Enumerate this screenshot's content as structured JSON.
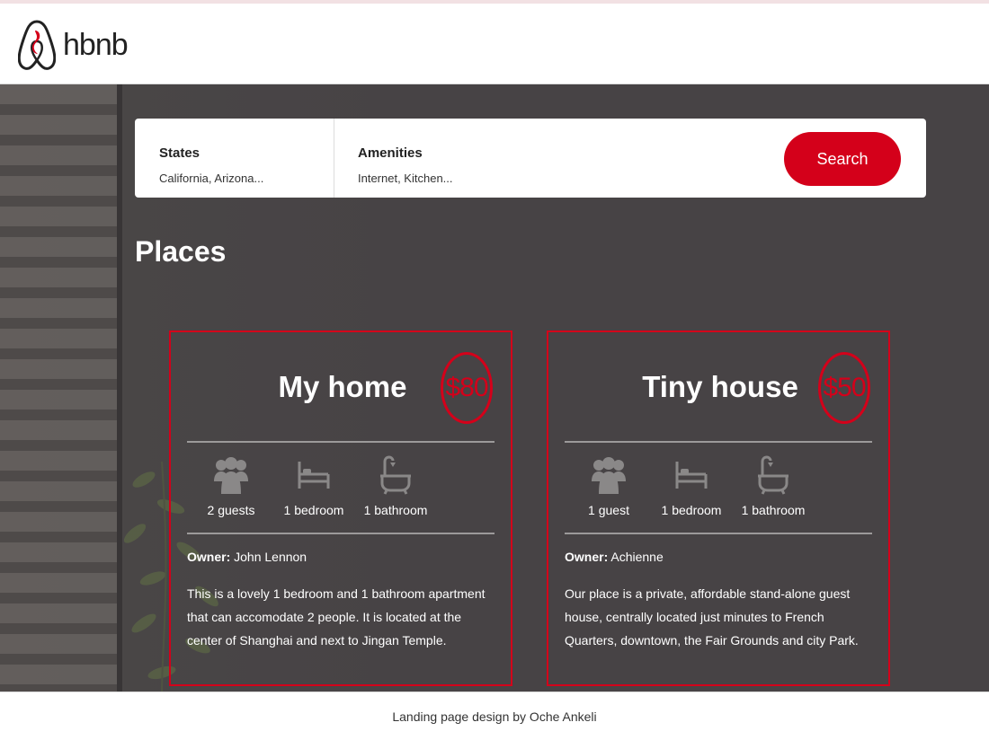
{
  "header": {
    "logo_text": "hbnb",
    "logo_icon": "hbnb-logo-icon"
  },
  "filters": {
    "states": {
      "title": "States",
      "value": "California, Arizona..."
    },
    "amenities": {
      "title": "Amenities",
      "value": "Internet, Kitchen..."
    },
    "search_label": "Search"
  },
  "places": {
    "title": "Places",
    "items": [
      {
        "name": "My home",
        "price": "$80",
        "guests": "2 guests",
        "bedrooms": "1 bedroom",
        "bathrooms": "1 bathroom",
        "owner_label": "Owner:",
        "owner": "John Lennon",
        "description": "This is a lovely 1 bedroom and 1 bathroom apartment that can accomodate 2 people. It is located at the center of Shanghai and next to Jingan Temple."
      },
      {
        "name": "Tiny house",
        "price": "$50",
        "guests": "1 guest",
        "bedrooms": "1 bedroom",
        "bathrooms": "1 bathroom",
        "owner_label": "Owner:",
        "owner": "Achienne",
        "description": "Our place is a private, affordable stand-alone guest house, centrally located just minutes to French Quarters, downtown, the Fair Grounds and city Park."
      }
    ]
  },
  "footer": {
    "text": "Landing page design by Oche Ankeli"
  },
  "colors": {
    "accent": "#d4001a",
    "header_bg": "#ffffff",
    "hero_overlay": "#474345",
    "text_light": "#ffffff"
  },
  "icons": [
    "hbnb-logo-icon",
    "guests-icon",
    "bed-icon",
    "bathtub-icon"
  ]
}
